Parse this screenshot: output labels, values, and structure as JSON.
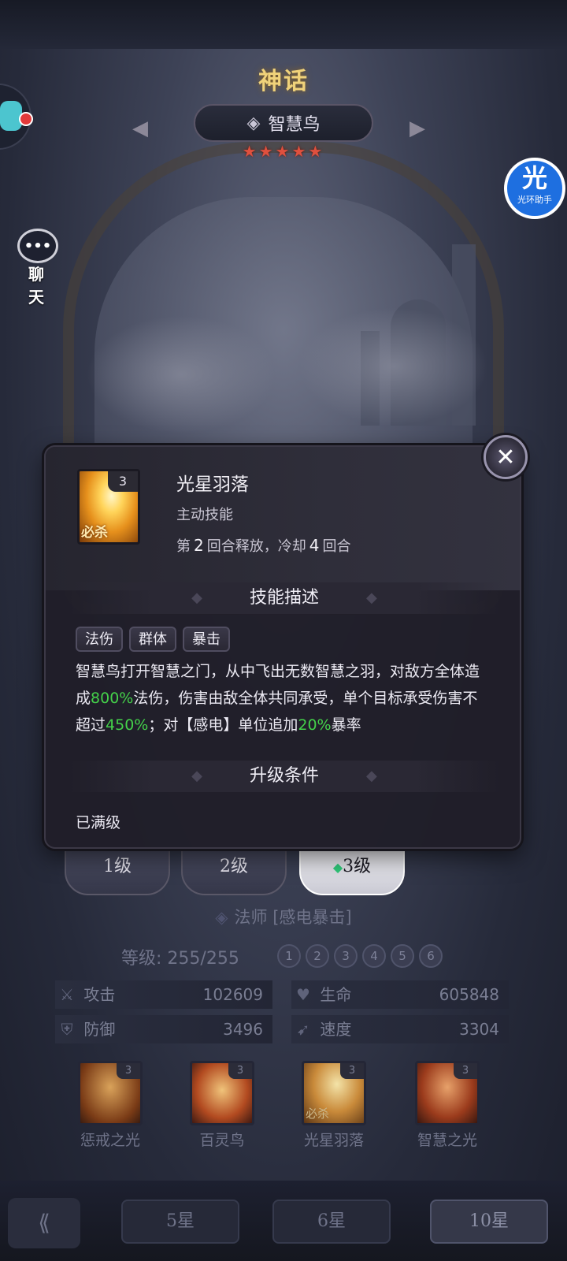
{
  "header": {
    "rarity": "神话",
    "hero_name": "智慧鸟",
    "stars": "★★★★★",
    "chat_label": "聊 天",
    "helper_big": "光",
    "helper_small": "光环助手"
  },
  "popup": {
    "skill_level": "3",
    "skill_ult_badge": "必杀",
    "skill_title": "光星羽落",
    "skill_type": "主动技能",
    "timing_prefix": "第",
    "timing_round": "2",
    "timing_mid": "回合释放，冷却",
    "timing_cd": "4",
    "timing_suffix": "回合",
    "desc_heading": "技能描述",
    "tags": [
      "法伤",
      "群体",
      "暴击"
    ],
    "desc_parts": [
      "智慧鸟打开智慧之门，从中飞出无数智慧之羽，对敌方全体造成",
      "800%",
      "法伤，伤害由敌全体共同承受，单个目标承受伤害不超过",
      "450%",
      "；对【感电】单位追加",
      "20%",
      "暴率"
    ],
    "upgrade_heading": "升级条件",
    "upgrade_text": "已满级"
  },
  "grades": [
    "1级",
    "2级",
    "3级"
  ],
  "role": "法师 [感电暴击]",
  "level": {
    "label": "等级:",
    "value": "255/255",
    "dots": [
      "1",
      "2",
      "3",
      "4",
      "5",
      "6"
    ]
  },
  "stats": {
    "attack_label": "攻击",
    "attack_value": "102609",
    "hp_label": "生命",
    "hp_value": "605848",
    "defense_label": "防御",
    "defense_value": "3496",
    "speed_label": "速度",
    "speed_value": "3304"
  },
  "skill_cards": [
    {
      "name": "惩戒之光",
      "level": "3",
      "ult": ""
    },
    {
      "name": "百灵鸟",
      "level": "3",
      "ult": ""
    },
    {
      "name": "光星羽落",
      "level": "3",
      "ult": "必杀"
    },
    {
      "name": "智慧之光",
      "level": "3",
      "ult": ""
    }
  ],
  "star_tabs": [
    "5星",
    "6星",
    "10星"
  ],
  "colors": {
    "highlight_green": "#44d14a",
    "rarity_gold": "#f0d27a",
    "star_red": "#e0503e"
  }
}
